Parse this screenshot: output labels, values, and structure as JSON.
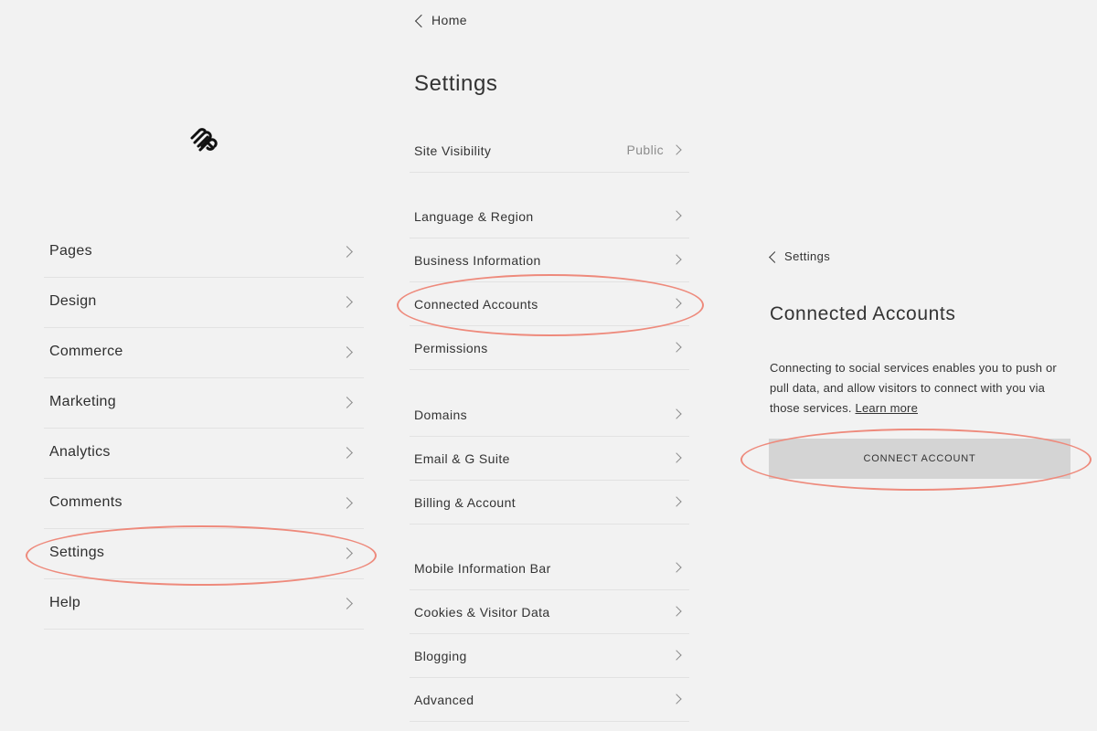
{
  "left_nav": {
    "items": [
      {
        "label": "Pages"
      },
      {
        "label": "Design"
      },
      {
        "label": "Commerce"
      },
      {
        "label": "Marketing"
      },
      {
        "label": "Analytics"
      },
      {
        "label": "Comments"
      },
      {
        "label": "Settings"
      },
      {
        "label": "Help"
      }
    ],
    "highlighted": "Settings"
  },
  "settings_panel": {
    "back_label": "Home",
    "title": "Settings",
    "groups": [
      [
        {
          "label": "Site Visibility",
          "value": "Public"
        }
      ],
      [
        {
          "label": "Language & Region"
        },
        {
          "label": "Business Information"
        },
        {
          "label": "Connected Accounts"
        },
        {
          "label": "Permissions"
        }
      ],
      [
        {
          "label": "Domains"
        },
        {
          "label": "Email & G Suite"
        },
        {
          "label": "Billing & Account"
        }
      ],
      [
        {
          "label": "Mobile Information Bar"
        },
        {
          "label": "Cookies & Visitor Data"
        },
        {
          "label": "Blogging"
        },
        {
          "label": "Advanced"
        }
      ]
    ],
    "highlighted": "Connected Accounts"
  },
  "connected_accounts_panel": {
    "back_label": "Settings",
    "title": "Connected Accounts",
    "description": "Connecting to social services enables you to push or pull data, and allow visitors to connect with you via those services.",
    "learn_more": "Learn more",
    "button_label": "CONNECT ACCOUNT"
  },
  "colors": {
    "background": "#f2f2f2",
    "annotation": "#ee8a7c",
    "button": "#d4d4d4"
  },
  "icons": [
    "squarespace-logo-icon",
    "chevron-right-icon",
    "chevron-left-icon"
  ]
}
